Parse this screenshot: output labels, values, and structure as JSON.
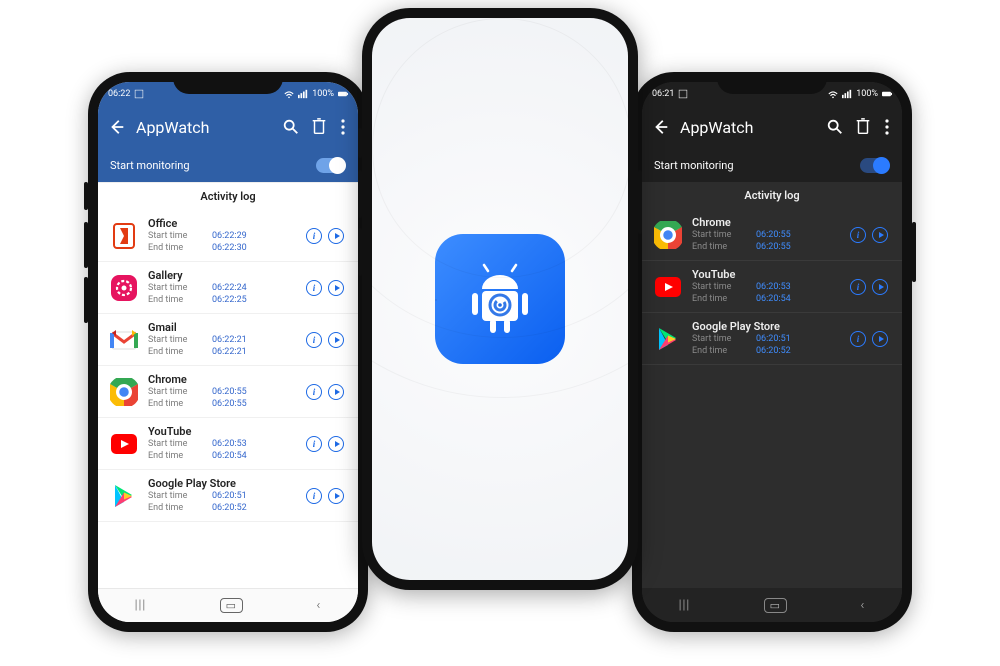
{
  "center": {
    "app_icon": "android-robot-icon"
  },
  "left": {
    "status": {
      "time": "06:22",
      "battery": "100%"
    },
    "app_title": "AppWatch",
    "monitor_label": "Start monitoring",
    "section_title": "Activity log",
    "logs": [
      {
        "app": "Office",
        "start_label": "Start time",
        "start": "06:22:29",
        "end_label": "End time",
        "end": "06:22:30",
        "icon": "office-icon"
      },
      {
        "app": "Gallery",
        "start_label": "Start time",
        "start": "06:22:24",
        "end_label": "End time",
        "end": "06:22:25",
        "icon": "gallery-icon"
      },
      {
        "app": "Gmail",
        "start_label": "Start time",
        "start": "06:22:21",
        "end_label": "End time",
        "end": "06:22:21",
        "icon": "gmail-icon"
      },
      {
        "app": "Chrome",
        "start_label": "Start time",
        "start": "06:20:55",
        "end_label": "End time",
        "end": "06:20:55",
        "icon": "chrome-icon"
      },
      {
        "app": "YouTube",
        "start_label": "Start time",
        "start": "06:20:53",
        "end_label": "End time",
        "end": "06:20:54",
        "icon": "youtube-icon"
      },
      {
        "app": "Google Play Store",
        "start_label": "Start time",
        "start": "06:20:51",
        "end_label": "End time",
        "end": "06:20:52",
        "icon": "play-store-icon"
      }
    ],
    "nav": {
      "recents": "|||",
      "home": "○",
      "back": "‹"
    }
  },
  "right": {
    "status": {
      "time": "06:21",
      "battery": "100%"
    },
    "app_title": "AppWatch",
    "monitor_label": "Start monitoring",
    "section_title": "Activity log",
    "logs": [
      {
        "app": "Chrome",
        "start_label": "Start time",
        "start": "06:20:55",
        "end_label": "End time",
        "end": "06:20:55",
        "icon": "chrome-icon"
      },
      {
        "app": "YouTube",
        "start_label": "Start time",
        "start": "06:20:53",
        "end_label": "End time",
        "end": "06:20:54",
        "icon": "youtube-icon"
      },
      {
        "app": "Google Play Store",
        "start_label": "Start time",
        "start": "06:20:51",
        "end_label": "End time",
        "end": "06:20:52",
        "icon": "play-store-icon"
      }
    ],
    "nav": {
      "recents": "|||",
      "home": "○",
      "back": "‹"
    }
  }
}
